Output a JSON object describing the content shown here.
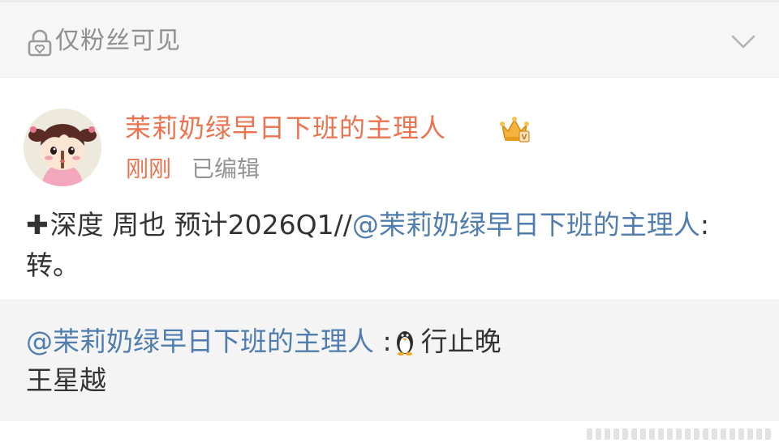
{
  "visibility": {
    "label": "仅粉丝可见",
    "icon": "lock-heart-icon",
    "collapse_icon": "chevron-down-icon"
  },
  "post": {
    "author": "茉莉奶绿早日下班的主理人",
    "badge_icon": "crown-badge-icon",
    "time": "刚刚",
    "edited": "已编辑",
    "body_prefix": "深度 周也  预计2026Q1//",
    "body_mention": "@茉莉奶绿早日下班的主理人",
    "body_suffix": ":转。"
  },
  "retweet": {
    "mention": "@茉莉奶绿早日下班的主理人",
    "separator": " :",
    "emoji_icon": "penguin-icon",
    "text_line1": "行止晚",
    "text_line2": "王星越"
  },
  "colors": {
    "accent_orange": "#eb7350",
    "link_blue": "#507daf",
    "text": "#333333",
    "muted": "#939393"
  }
}
